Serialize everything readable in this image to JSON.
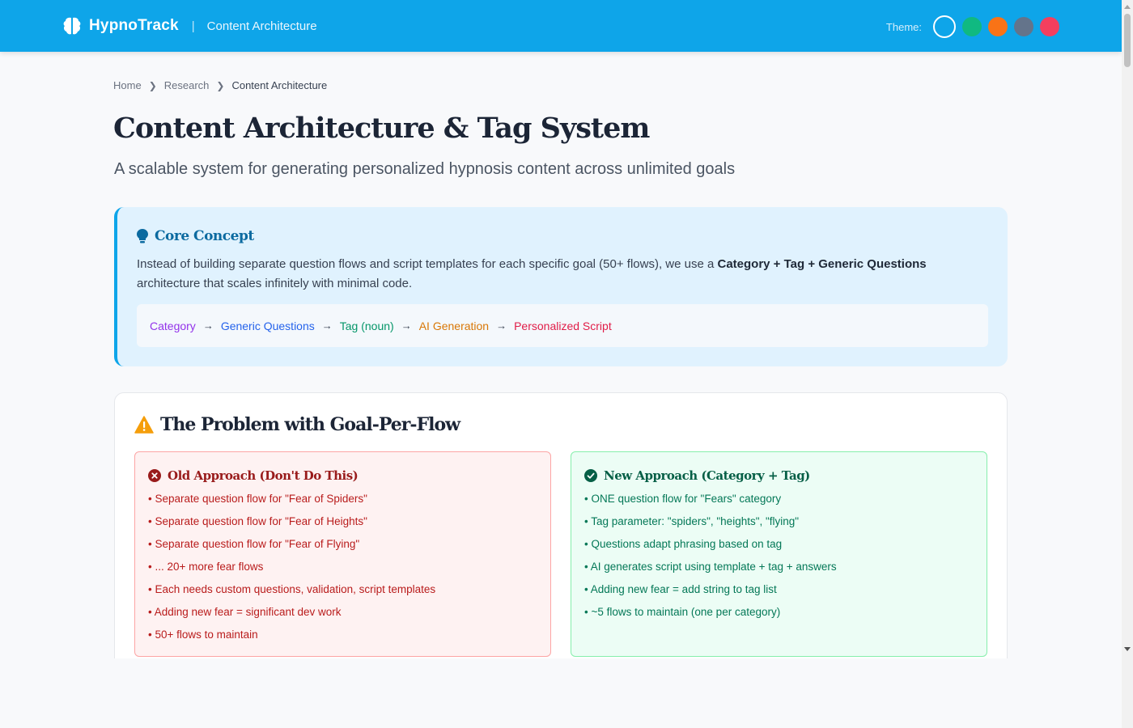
{
  "header": {
    "brand": "HypnoTrack",
    "separator": "|",
    "page": "Content Architecture",
    "theme_label": "Theme:",
    "theme_swatches": [
      {
        "name": "sky",
        "color": "#0ea5e9",
        "active": true
      },
      {
        "name": "green",
        "color": "#10b981",
        "active": false
      },
      {
        "name": "orange",
        "color": "#f97316",
        "active": false
      },
      {
        "name": "slate",
        "color": "#64748b",
        "active": false
      },
      {
        "name": "rose",
        "color": "#f43f5e",
        "active": false
      }
    ]
  },
  "breadcrumb": [
    "Home",
    "Research",
    "Content Architecture"
  ],
  "page": {
    "title": "Content Architecture & Tag System",
    "subtitle": "A scalable system for generating personalized hypnosis content across unlimited goals"
  },
  "core_concept": {
    "title": "Core Concept",
    "body_prefix": "Instead of building separate question flows and script templates for each specific goal (50+ flows), we use a ",
    "body_bold": "Category + Tag + Generic Questions",
    "body_suffix": " architecture that scales infinitely with minimal code.",
    "flow": [
      {
        "label": "Category",
        "color": "#9333ea"
      },
      {
        "label": "Generic Questions",
        "color": "#2563eb"
      },
      {
        "label": "Tag (noun)",
        "color": "#059669"
      },
      {
        "label": "AI Generation",
        "color": "#d97706"
      },
      {
        "label": "Personalized Script",
        "color": "#e11d48"
      }
    ],
    "flow_arrow": "→"
  },
  "problem": {
    "title": "The Problem with Goal-Per-Flow",
    "old": {
      "title": "Old Approach (Don't Do This)",
      "items": [
        "• Separate question flow for \"Fear of Spiders\"",
        "• Separate question flow for \"Fear of Heights\"",
        "• Separate question flow for \"Fear of Flying\"",
        "• ... 20+ more fear flows",
        "• Each needs custom questions, validation, script templates",
        "• Adding new fear = significant dev work",
        "• 50+ flows to maintain"
      ]
    },
    "new": {
      "title": "New Approach (Category + Tag)",
      "items": [
        "• ONE question flow for \"Fears\" category",
        "• Tag parameter: \"spiders\", \"heights\", \"flying\"",
        "• Questions adapt phrasing based on tag",
        "• AI generates script using template + tag + answers",
        "• Adding new fear = add string to tag list",
        "• ~5 flows to maintain (one per category)"
      ]
    }
  }
}
